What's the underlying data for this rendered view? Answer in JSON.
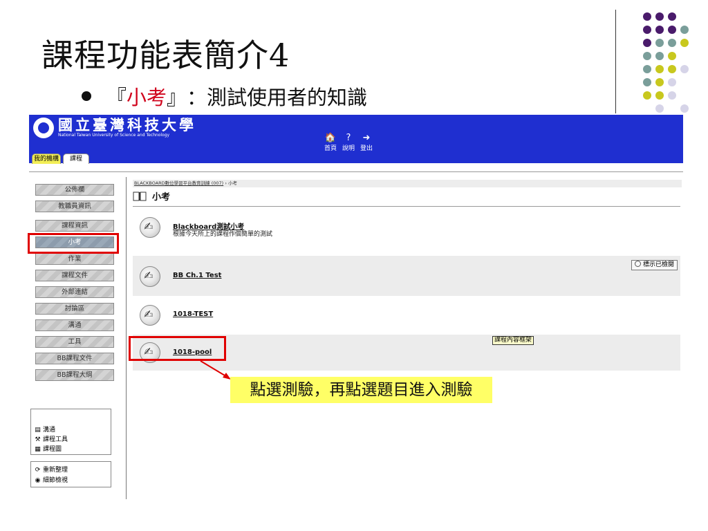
{
  "slide": {
    "title": "課程功能表簡介4",
    "bullet": {
      "open": "『",
      "keyword": "小考",
      "close": "』",
      "rest": "：測試使用者的知識"
    },
    "callout": "點選測驗，再點選題目進入測驗",
    "accent_colors": {
      "purple": "#4a1b6b",
      "teal": "#7a9e9a",
      "olive": "#c8c81e",
      "lilac": "#d6d4e8",
      "red": "#d0021b"
    }
  },
  "app": {
    "logo": {
      "chinese": "國立臺灣科技大學",
      "english": "National Taiwan University of Science and Technology"
    },
    "nav": [
      {
        "icon": "home-icon",
        "glyph": "🏠",
        "label": "首頁"
      },
      {
        "icon": "help-icon",
        "glyph": "?",
        "label": "說明"
      },
      {
        "icon": "logout-icon",
        "glyph": "➜",
        "label": "登出"
      }
    ],
    "tabs": [
      "我的機構",
      "課程"
    ],
    "brand_color": "#1f2fd0"
  },
  "sidebar": {
    "menu": [
      "公佈欄",
      "教職員資訊",
      "課程資訊",
      "小考",
      "作業",
      "課程文件",
      "外部連結",
      "討論區",
      "溝通",
      "工具",
      "BB課程文件",
      "BB課程大綱"
    ],
    "active_index": 3,
    "tools": [
      "溝通",
      "課程工具",
      "課程圖"
    ],
    "actions": [
      "重新整理",
      "細節檢視"
    ]
  },
  "content": {
    "breadcrumb": {
      "link": "BLACKBOARD數位學習平台教育訓練 (007)",
      "sep": "›",
      "current": "小考"
    },
    "heading": "小考",
    "items": [
      {
        "title": "Blackboard測試小考",
        "description": "根據今天所上的課程作個簡單的測試"
      },
      {
        "title": "BB Ch.1 Test",
        "description": ""
      },
      {
        "title": "1018-TEST",
        "description": ""
      },
      {
        "title": "1018-pool",
        "description": ""
      }
    ],
    "mark_reviewed": "標示已檢閱",
    "frame_label": "課程內容框架"
  }
}
